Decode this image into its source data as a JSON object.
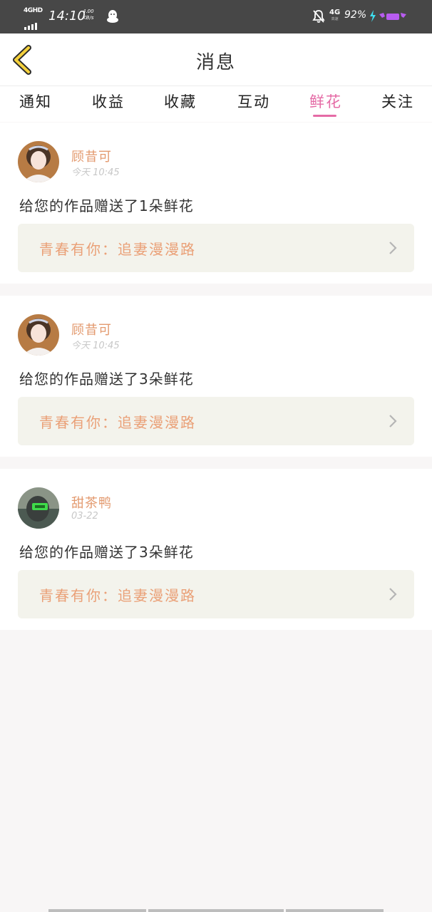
{
  "status_bar": {
    "network": "4GHD",
    "time": "14:10",
    "speed_value": "4.00",
    "speed_unit": "KB/s",
    "network_right": "4G",
    "network_right_sub": "高速",
    "battery": "92%",
    "icons": [
      "qq-penguin-icon",
      "bell-off-icon",
      "charging-bolt-icon"
    ]
  },
  "header": {
    "title": "消息",
    "back_icon": "chevron-left-icon",
    "accent_color": "#f5d13d"
  },
  "tabs": [
    {
      "label": "通知",
      "active": false
    },
    {
      "label": "收益",
      "active": false
    },
    {
      "label": "收藏",
      "active": false
    },
    {
      "label": "互动",
      "active": false
    },
    {
      "label": "鲜花",
      "active": true
    },
    {
      "label": "关注",
      "active": false
    }
  ],
  "colors": {
    "active_tab": "#e56ba6",
    "sender_name": "#e39a6f",
    "work_title": "#eaa077",
    "work_bg": "#f3f3ec"
  },
  "messages": [
    {
      "sender": "顾昔可",
      "time": "今天 10:45",
      "text": "给您的作品赠送了1朵鲜花",
      "work_title": "青春有你：追妻漫漫路"
    },
    {
      "sender": "顾昔可",
      "time": "今天 10:45",
      "text": "给您的作品赠送了3朵鲜花",
      "work_title": "青春有你：追妻漫漫路"
    },
    {
      "sender": "甜茶鸭",
      "time": "03-22",
      "text": "给您的作品赠送了3朵鲜花",
      "work_title": "青春有你：追妻漫漫路"
    }
  ]
}
